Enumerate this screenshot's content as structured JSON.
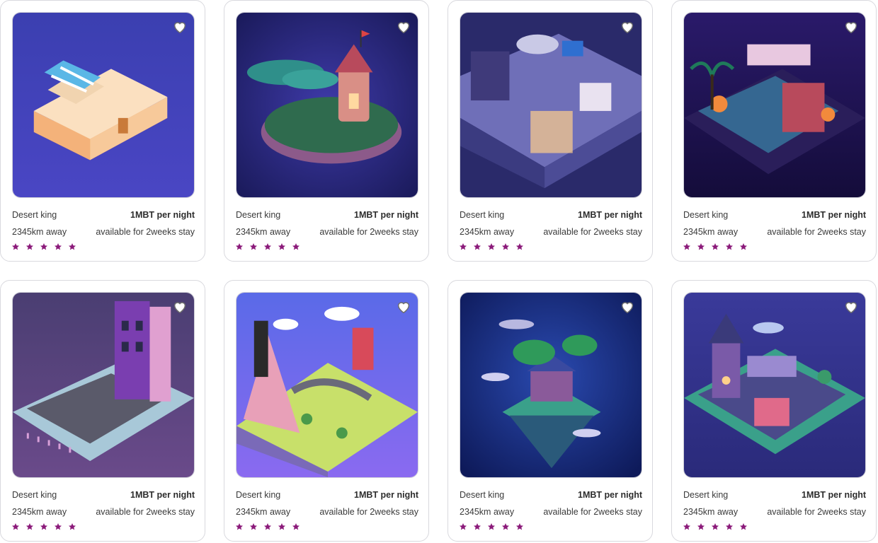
{
  "colors": {
    "star": "#8b1a7a",
    "border": "#d9d9de",
    "heart_fill": "#ffffff",
    "heart_stroke": "#6d6d6d"
  },
  "listings": [
    {
      "name": "Desert king",
      "price": "1MBT per night",
      "distance": "2345km away",
      "availability": "available for 2weeks stay",
      "rating": 5,
      "scene": "desert-house"
    },
    {
      "name": "Desert king",
      "price": "1MBT per night",
      "distance": "2345km away",
      "availability": "available for 2weeks stay",
      "rating": 5,
      "scene": "tower-island"
    },
    {
      "name": "Desert king",
      "price": "1MBT per night",
      "distance": "2345km away",
      "availability": "available for 2weeks stay",
      "rating": 5,
      "scene": "sci-fi-base"
    },
    {
      "name": "Desert king",
      "price": "1MBT per night",
      "distance": "2345km away",
      "availability": "available for 2weeks stay",
      "rating": 5,
      "scene": "jungle-temple"
    },
    {
      "name": "Desert king",
      "price": "1MBT per night",
      "distance": "2345km away",
      "availability": "available for 2weeks stay",
      "rating": 5,
      "scene": "purple-building"
    },
    {
      "name": "Desert king",
      "price": "1MBT per night",
      "distance": "2345km away",
      "availability": "available for 2weeks stay",
      "rating": 5,
      "scene": "city-island"
    },
    {
      "name": "Desert king",
      "price": "1MBT per night",
      "distance": "2345km away",
      "availability": "available for 2weeks stay",
      "rating": 5,
      "scene": "floating-house"
    },
    {
      "name": "Desert king",
      "price": "1MBT per night",
      "distance": "2345km away",
      "availability": "available for 2weeks stay",
      "rating": 5,
      "scene": "night-city"
    }
  ]
}
